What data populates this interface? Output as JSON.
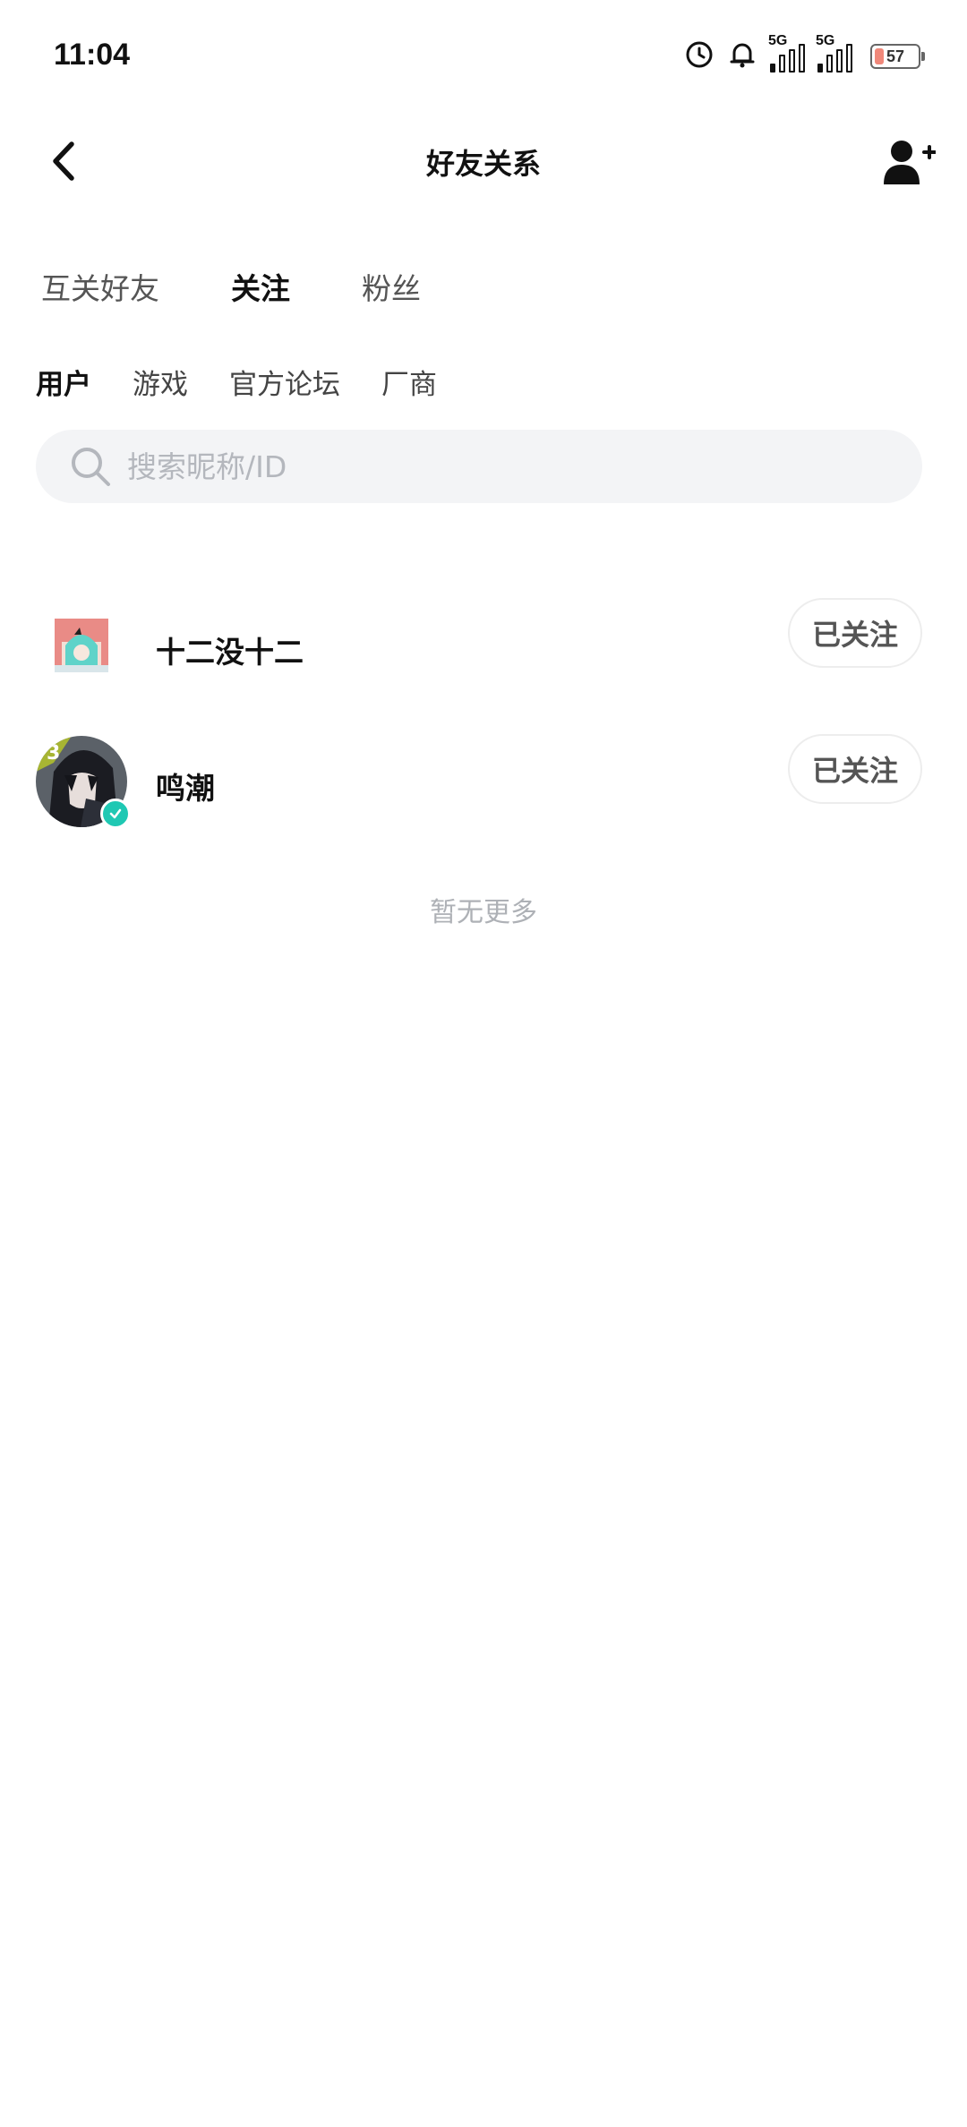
{
  "status_bar": {
    "time": "11:04",
    "network_1": "5G",
    "network_2": "5G",
    "battery": "57",
    "icons": [
      "alarm-icon",
      "notification-icon",
      "signal-icon",
      "signal-icon",
      "battery-icon"
    ]
  },
  "header": {
    "title": "好友关系",
    "back_icon": "chevron-left-icon",
    "add_icon": "add-user-icon"
  },
  "main_tabs": [
    {
      "label": "互关好友",
      "active": false
    },
    {
      "label": "关注",
      "active": true
    },
    {
      "label": "粉丝",
      "active": false
    }
  ],
  "sub_tabs": [
    {
      "label": "用户",
      "active": true
    },
    {
      "label": "游戏",
      "active": false
    },
    {
      "label": "官方论坛",
      "active": false
    },
    {
      "label": "厂商",
      "active": false
    }
  ],
  "search": {
    "placeholder": "搜索昵称/ID",
    "value": ""
  },
  "users": [
    {
      "name": "十二没十二",
      "button": "已关注",
      "verified": false
    },
    {
      "name": "鸣潮",
      "button": "已关注",
      "verified": true
    }
  ],
  "footer_text": "暂无更多",
  "colors": {
    "accent": "#1fc8b3",
    "search_bg": "#f3f4f6",
    "muted_text": "#aeb1b6"
  }
}
